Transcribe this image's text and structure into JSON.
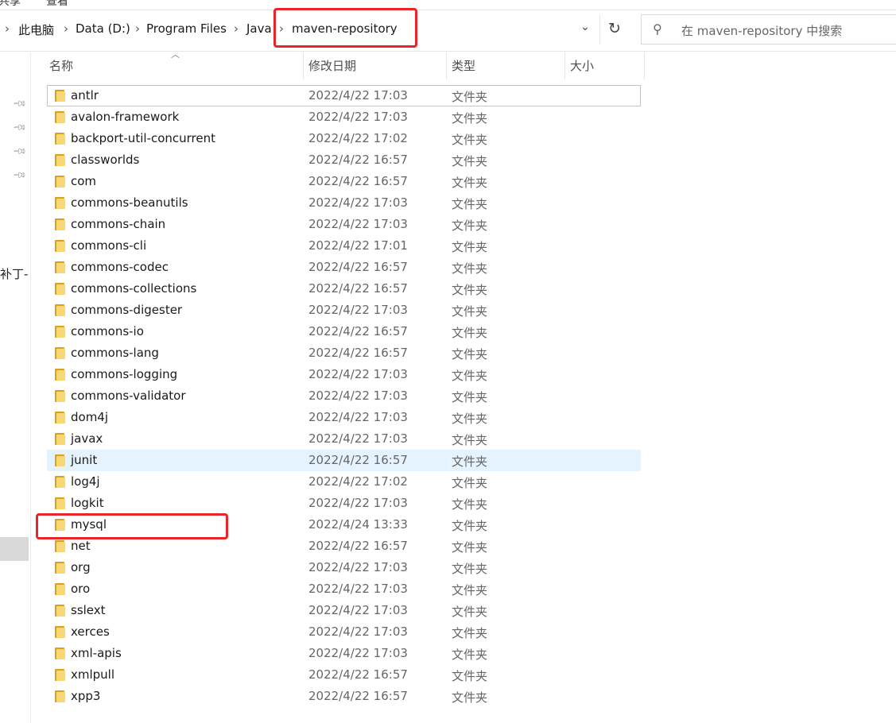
{
  "top_menu": {
    "left_fragment": "共享",
    "right_fragment": "查看"
  },
  "breadcrumb": [
    "此电脑",
    "Data (D:)",
    "Program Files",
    "Java",
    "maven-repository"
  ],
  "search": {
    "placeholder": "在 maven-repository 中搜索"
  },
  "nav": {
    "partial_label": "补丁-"
  },
  "columns": {
    "name": "名称",
    "date": "修改日期",
    "type": "类型",
    "size": "大小"
  },
  "files": [
    {
      "name": "antlr",
      "date": "2022/4/22 17:03",
      "type": "文件夹"
    },
    {
      "name": "avalon-framework",
      "date": "2022/4/22 17:03",
      "type": "文件夹"
    },
    {
      "name": "backport-util-concurrent",
      "date": "2022/4/22 17:02",
      "type": "文件夹"
    },
    {
      "name": "classworlds",
      "date": "2022/4/22 16:57",
      "type": "文件夹"
    },
    {
      "name": "com",
      "date": "2022/4/22 16:57",
      "type": "文件夹"
    },
    {
      "name": "commons-beanutils",
      "date": "2022/4/22 17:03",
      "type": "文件夹"
    },
    {
      "name": "commons-chain",
      "date": "2022/4/22 17:03",
      "type": "文件夹"
    },
    {
      "name": "commons-cli",
      "date": "2022/4/22 17:01",
      "type": "文件夹"
    },
    {
      "name": "commons-codec",
      "date": "2022/4/22 16:57",
      "type": "文件夹"
    },
    {
      "name": "commons-collections",
      "date": "2022/4/22 16:57",
      "type": "文件夹"
    },
    {
      "name": "commons-digester",
      "date": "2022/4/22 17:03",
      "type": "文件夹"
    },
    {
      "name": "commons-io",
      "date": "2022/4/22 16:57",
      "type": "文件夹"
    },
    {
      "name": "commons-lang",
      "date": "2022/4/22 16:57",
      "type": "文件夹"
    },
    {
      "name": "commons-logging",
      "date": "2022/4/22 17:03",
      "type": "文件夹"
    },
    {
      "name": "commons-validator",
      "date": "2022/4/22 17:03",
      "type": "文件夹"
    },
    {
      "name": "dom4j",
      "date": "2022/4/22 17:03",
      "type": "文件夹"
    },
    {
      "name": "javax",
      "date": "2022/4/22 17:03",
      "type": "文件夹"
    },
    {
      "name": "junit",
      "date": "2022/4/22 16:57",
      "type": "文件夹"
    },
    {
      "name": "log4j",
      "date": "2022/4/22 17:02",
      "type": "文件夹"
    },
    {
      "name": "logkit",
      "date": "2022/4/22 17:03",
      "type": "文件夹"
    },
    {
      "name": "mysql",
      "date": "2022/4/24 13:33",
      "type": "文件夹"
    },
    {
      "name": "net",
      "date": "2022/4/22 16:57",
      "type": "文件夹"
    },
    {
      "name": "org",
      "date": "2022/4/22 17:03",
      "type": "文件夹"
    },
    {
      "name": "oro",
      "date": "2022/4/22 17:03",
      "type": "文件夹"
    },
    {
      "name": "sslext",
      "date": "2022/4/22 17:03",
      "type": "文件夹"
    },
    {
      "name": "xerces",
      "date": "2022/4/22 17:03",
      "type": "文件夹"
    },
    {
      "name": "xml-apis",
      "date": "2022/4/22 17:03",
      "type": "文件夹"
    },
    {
      "name": "xmlpull",
      "date": "2022/4/22 16:57",
      "type": "文件夹"
    },
    {
      "name": "xpp3",
      "date": "2022/4/22 16:57",
      "type": "文件夹"
    }
  ],
  "colors": {
    "annotation": "#e8262a",
    "hover_row": "#e5f3ff",
    "focus_border": "#99d1f0",
    "folder": "#f8d775"
  },
  "icons": {
    "refresh": "refresh-icon",
    "search": "search-icon",
    "dropdown": "chevron-down-icon",
    "pin": "pin-icon",
    "folder": "folder-icon"
  }
}
